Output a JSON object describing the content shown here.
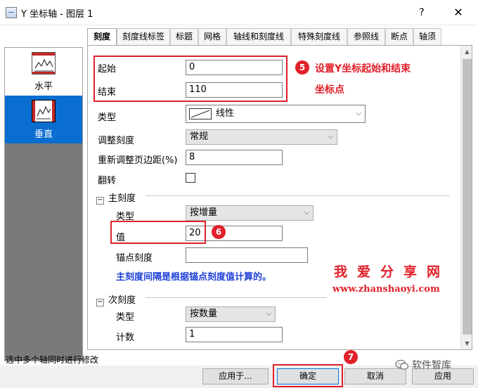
{
  "window": {
    "title": "Y 坐标轴 - 图层 1",
    "help_label": "?",
    "close_label": "✕"
  },
  "nav": {
    "items": [
      {
        "label": "水平",
        "selected": false,
        "icon": "horizontal-axis-thumbnail"
      },
      {
        "label": "垂直",
        "selected": true,
        "icon": "vertical-axis-thumbnail"
      }
    ]
  },
  "tabs": [
    "刻度",
    "刻度线标签",
    "标题",
    "网格",
    "轴线和刻度线",
    "特殊刻度线",
    "参照线",
    "断点",
    "轴须"
  ],
  "form": {
    "start": {
      "label": "起始",
      "value": "0"
    },
    "end": {
      "label": "结束",
      "value": "110"
    },
    "type": {
      "label": "类型",
      "value": "线性",
      "icon": "linear-scale-icon"
    },
    "rescale": {
      "label": "调整刻度",
      "value": "常规"
    },
    "rescale_margin": {
      "label": "重新调整页边距(%)",
      "value": "8"
    },
    "flip": {
      "label": "翻转",
      "checked": false
    }
  },
  "major": {
    "title": "主刻度",
    "type": {
      "label": "类型",
      "value": "按增量"
    },
    "value": {
      "label": "值",
      "value": "20"
    },
    "anchor": {
      "label": "锚点刻度",
      "value": ""
    },
    "note": "主刻度间隔是根据锚点刻度值计算的。"
  },
  "minor": {
    "title": "次刻度",
    "type": {
      "label": "类型",
      "value": "按数量"
    },
    "count": {
      "label": "计数",
      "value": "1"
    }
  },
  "annotations": {
    "step5_badge": "5",
    "step5_text_line1": "设置Y坐标起始和结束",
    "step5_text_line2": "坐标点",
    "step6_badge": "6",
    "step7_badge": "7"
  },
  "watermark": {
    "title": "我爱分享网",
    "url": "www.zhanshaoyi.com"
  },
  "status_text": "选中多个轴同时进行修改",
  "buttons": {
    "apply_to": "应用于...",
    "ok": "确定",
    "cancel": "取消",
    "apply": "应用"
  },
  "wechat_label": "软件智库",
  "colors": {
    "accent": "#e0202a",
    "selected_nav": "#0a6ed1",
    "note_blue": "#1d3fd6"
  }
}
